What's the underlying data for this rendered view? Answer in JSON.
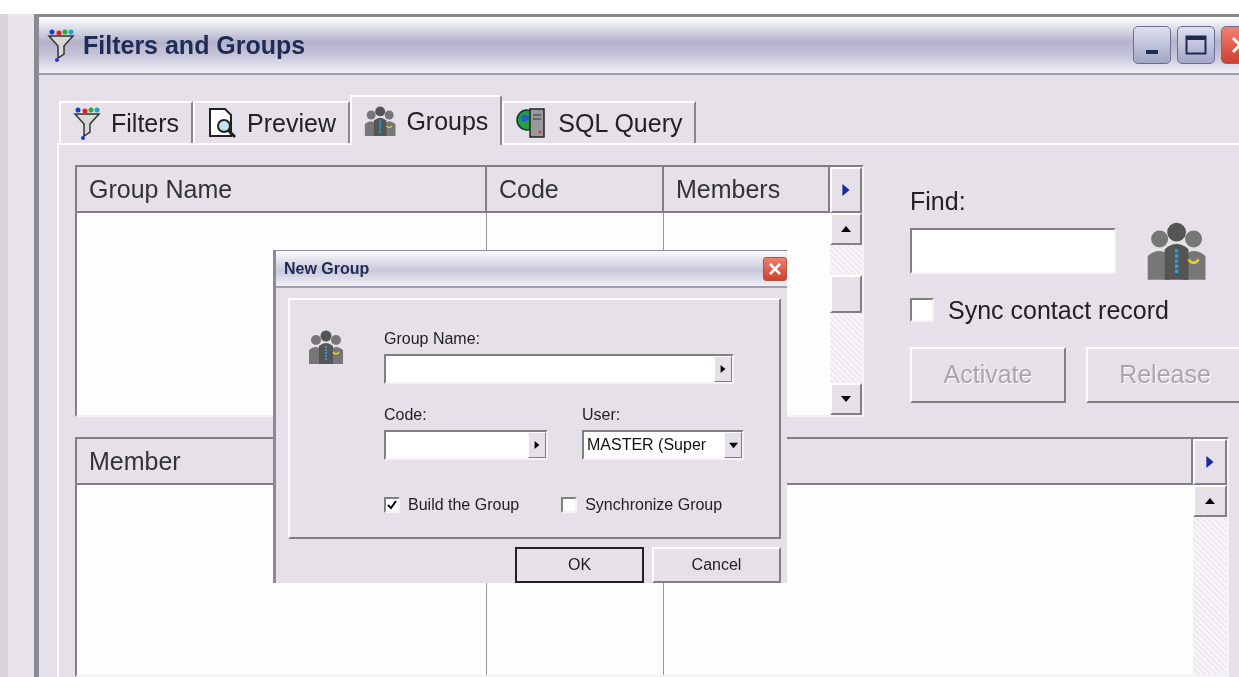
{
  "window": {
    "title": "Filters and Groups"
  },
  "tabs": [
    {
      "label": "Filters",
      "kind": "funnel",
      "selected": false
    },
    {
      "label": "Preview",
      "kind": "preview",
      "selected": false
    },
    {
      "label": "Groups",
      "kind": "people",
      "selected": true
    },
    {
      "label": "SQL Query",
      "kind": "sql",
      "selected": false
    }
  ],
  "groups_table": {
    "columns": [
      "Group Name",
      "Code",
      "Members"
    ]
  },
  "find": {
    "label": "Find:"
  },
  "sync_contact": {
    "label": "Sync contact record",
    "checked": false
  },
  "actions": [
    {
      "label": "Activate",
      "disabled": true
    },
    {
      "label": "Release",
      "disabled": true
    }
  ],
  "members_table": {
    "columns": [
      "Member"
    ]
  },
  "dialog": {
    "title": "New Group",
    "group_name": {
      "label": "Group Name:"
    },
    "code": {
      "label": "Code:"
    },
    "user": {
      "label": "User:",
      "value": "MASTER (Super"
    },
    "checkboxes": [
      {
        "label": "Build the Group",
        "checked": true
      },
      {
        "label": "Synchronize Group",
        "checked": false
      }
    ],
    "buttons": [
      {
        "label": "OK",
        "default": true
      },
      {
        "label": "Cancel",
        "default": false
      }
    ]
  }
}
